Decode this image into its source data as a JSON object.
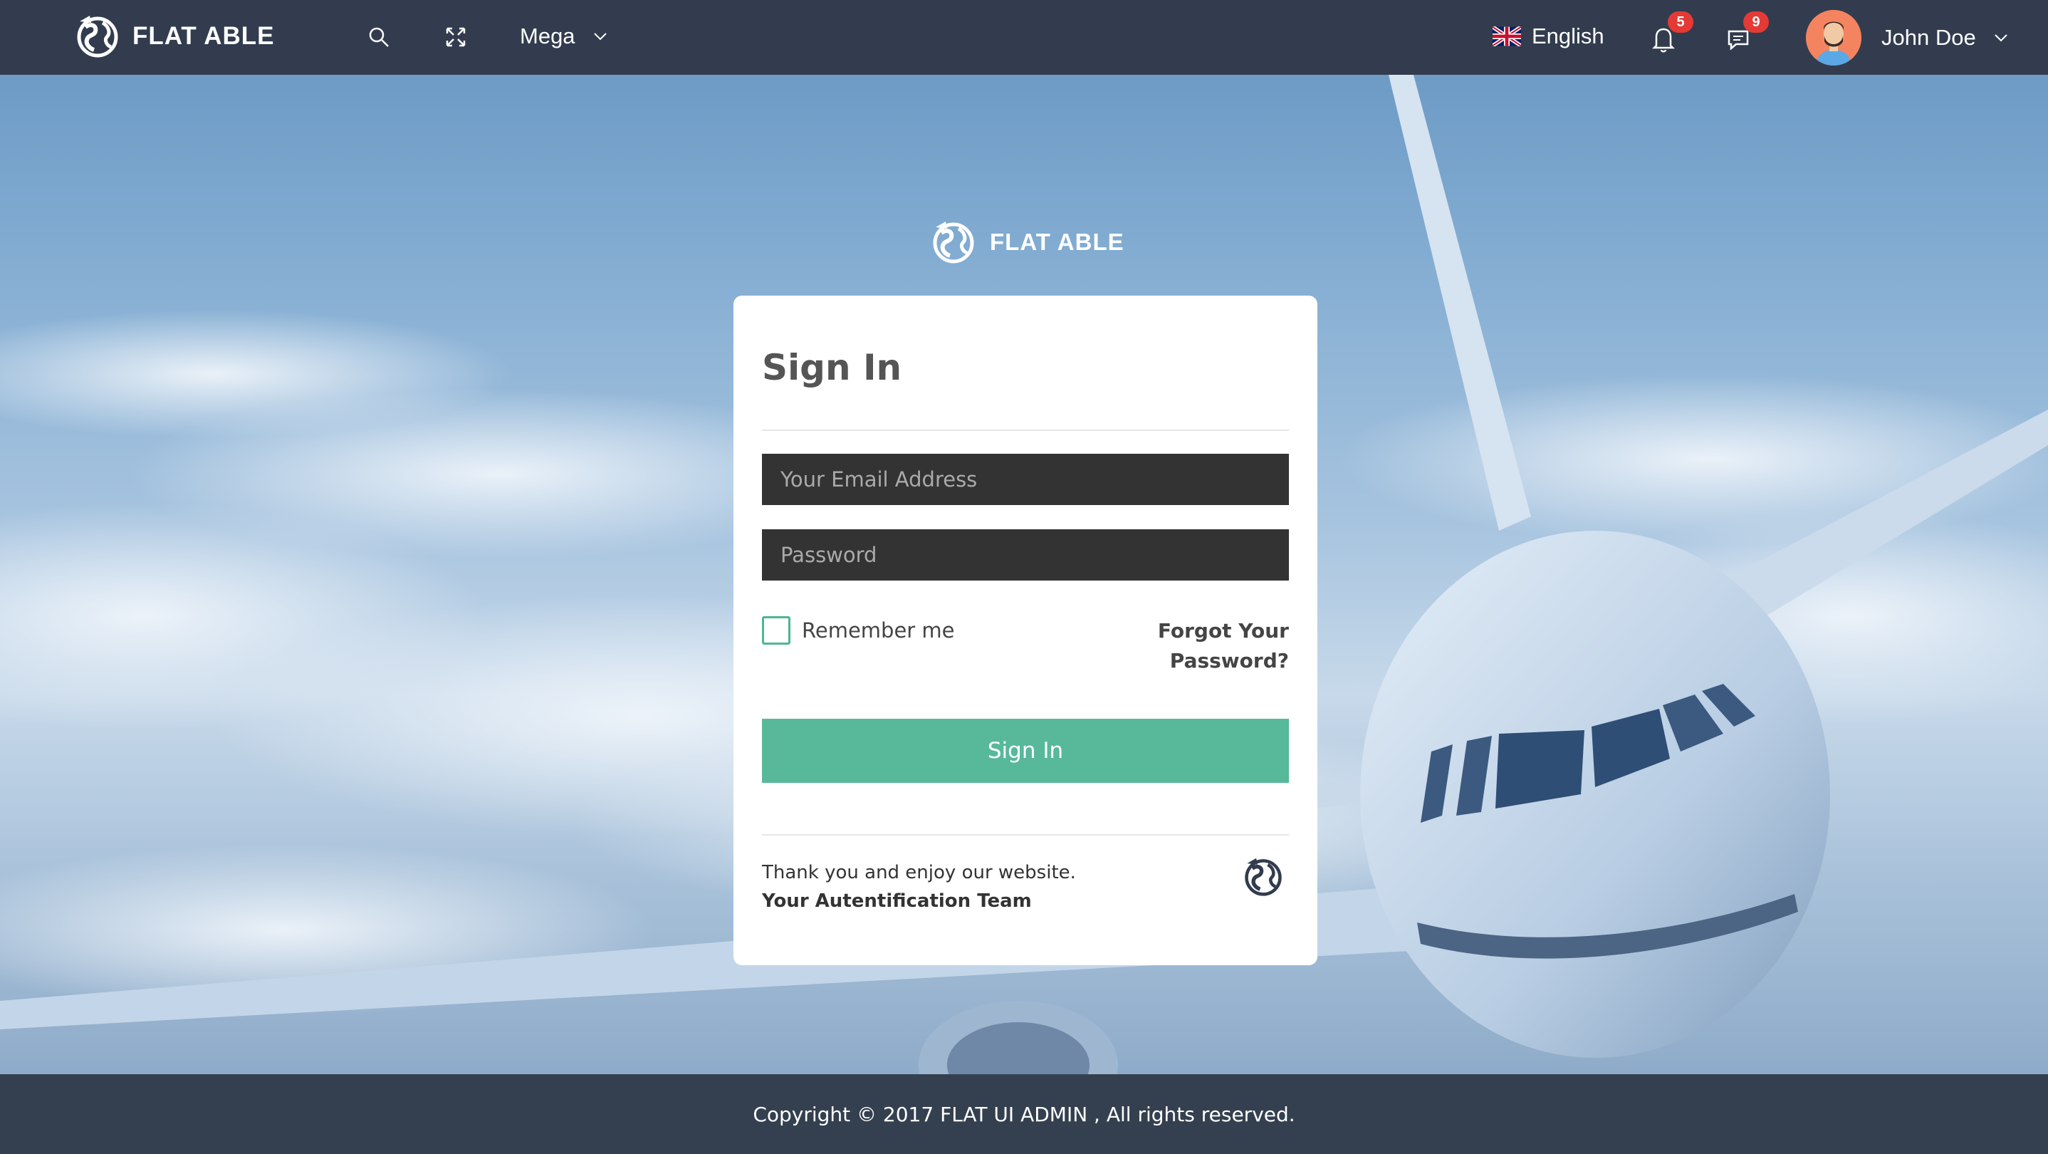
{
  "navbar": {
    "brand_name": "FLAT ABLE",
    "mega_label": "Mega",
    "language": "English",
    "notifications_count": "5",
    "messages_count": "9",
    "user_name": "John Doe",
    "icons": [
      "globe-logo-icon",
      "search-icon",
      "fullscreen-icon",
      "chevron-down-icon",
      "uk-flag-icon",
      "bell-icon",
      "chat-icon",
      "avatar"
    ]
  },
  "center_brand": {
    "name": "FLAT ABLE"
  },
  "signin": {
    "title": "Sign In",
    "email_placeholder": "Your Email Address",
    "password_placeholder": "Password",
    "remember_label": "Remember me",
    "forgot_label": "Forgot Your Password?",
    "button_label": "Sign In",
    "thanks_line": "Thank you and enjoy our website.",
    "team_line": "Your Autentification Team"
  },
  "footer": {
    "copyright": "Copyright © 2017 FLAT UI ADMIN , All rights reserved."
  },
  "colors": {
    "navbar_bg": "#323c4e",
    "accent_green": "#57b99a",
    "badge_red": "#e53935",
    "input_bg": "#333333"
  }
}
